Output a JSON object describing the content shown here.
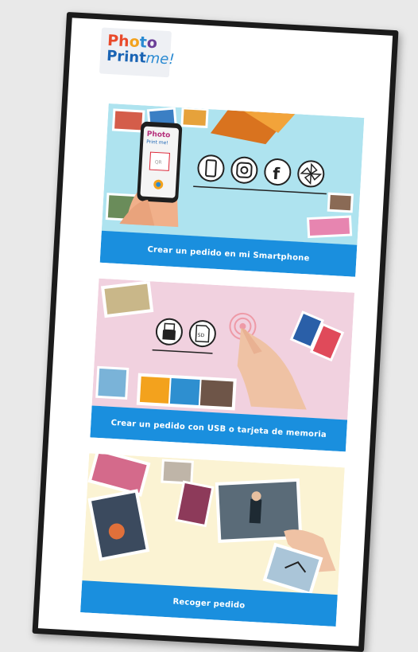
{
  "logo": {
    "line1": "Photo",
    "line2a": "Print",
    "line2b": "me!"
  },
  "phone": {
    "brand_line1": "Photo",
    "brand_line2": "Print me!",
    "qr": "QR"
  },
  "sd_label": "SD",
  "options": [
    {
      "label": "Crear un pedido en mi Smartphone"
    },
    {
      "label": "Crear un pedido con USB o tarjeta de memoria"
    },
    {
      "label": "Recoger pedido"
    }
  ],
  "colors": {
    "option_bar": "#1a8fde",
    "card1_bg": "#aee3ef",
    "card2_bg": "#f1d1df",
    "card3_bg": "#fbf3d3"
  },
  "icons": {
    "card1": [
      "smartphone-icon",
      "instagram-icon",
      "facebook-icon",
      "pinwheel-icon"
    ],
    "card2": [
      "usb-drive-icon",
      "sd-card-icon"
    ]
  }
}
